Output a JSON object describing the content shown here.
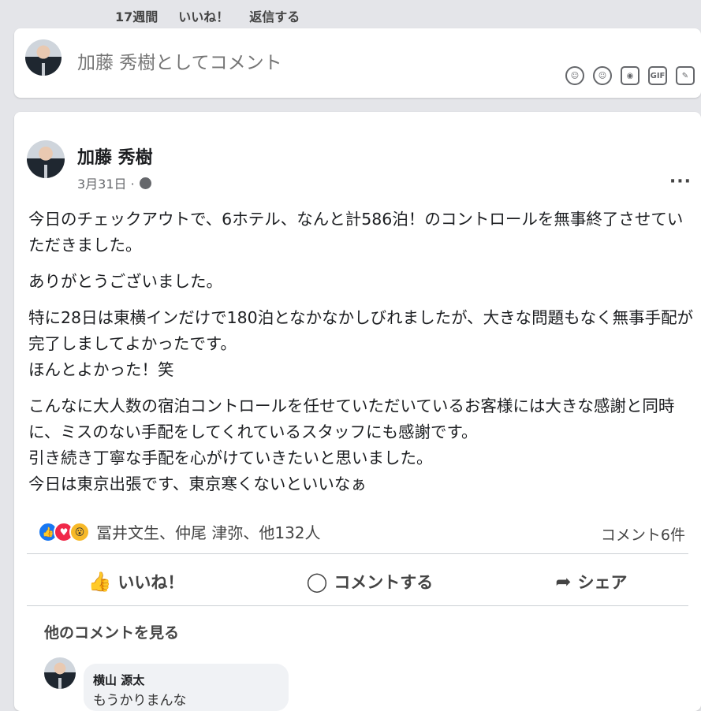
{
  "previous_comment": {
    "time": "17週間",
    "like_label": "いいね！",
    "reply_label": "返信する"
  },
  "comment_box": {
    "placeholder": "加藤 秀樹としてコメント",
    "tools": [
      "sticker-icon",
      "emoji-icon",
      "camera-icon",
      "gif-icon",
      "sticker-alt-icon"
    ],
    "gif_label": "GIF"
  },
  "post": {
    "author": "加藤 秀樹",
    "date": "3月31日 ·",
    "more": "···",
    "paragraphs": [
      "今日のチェックアウトで、6ホテル、なんと計586泊！のコントロールを無事終了させていただきました。",
      "ありがとうございました。",
      "特に28日は東横インだけで180泊となかなかしびれましたが、大きな問題もなく無事手配が完了しましてよかったです。\nほんとよかった！笑",
      "こんなに大人数の宿泊コントロールを任せていただいているお客様には大きな感謝と同時に、ミスのない手配をしてくれているスタッフにも感謝です。\n引き続き丁寧な手配を心がけていきたいと思いました。\n今日は東京出張です、東京寒くないといいなぁ"
    ],
    "reactions_text": "冨井文生、仲尾 津弥、他132人",
    "comment_count": "コメント6件",
    "actions": {
      "like": "いいね！",
      "comment": "コメントする",
      "share": "シェア"
    },
    "more_comments": "他のコメントを見る"
  },
  "reply": {
    "name": "横山 源太",
    "text": "もうかりまんな"
  },
  "colors": {
    "like_blue": "#1877f2",
    "love_red": "#f02849",
    "wow_yellow": "#f7b928"
  }
}
